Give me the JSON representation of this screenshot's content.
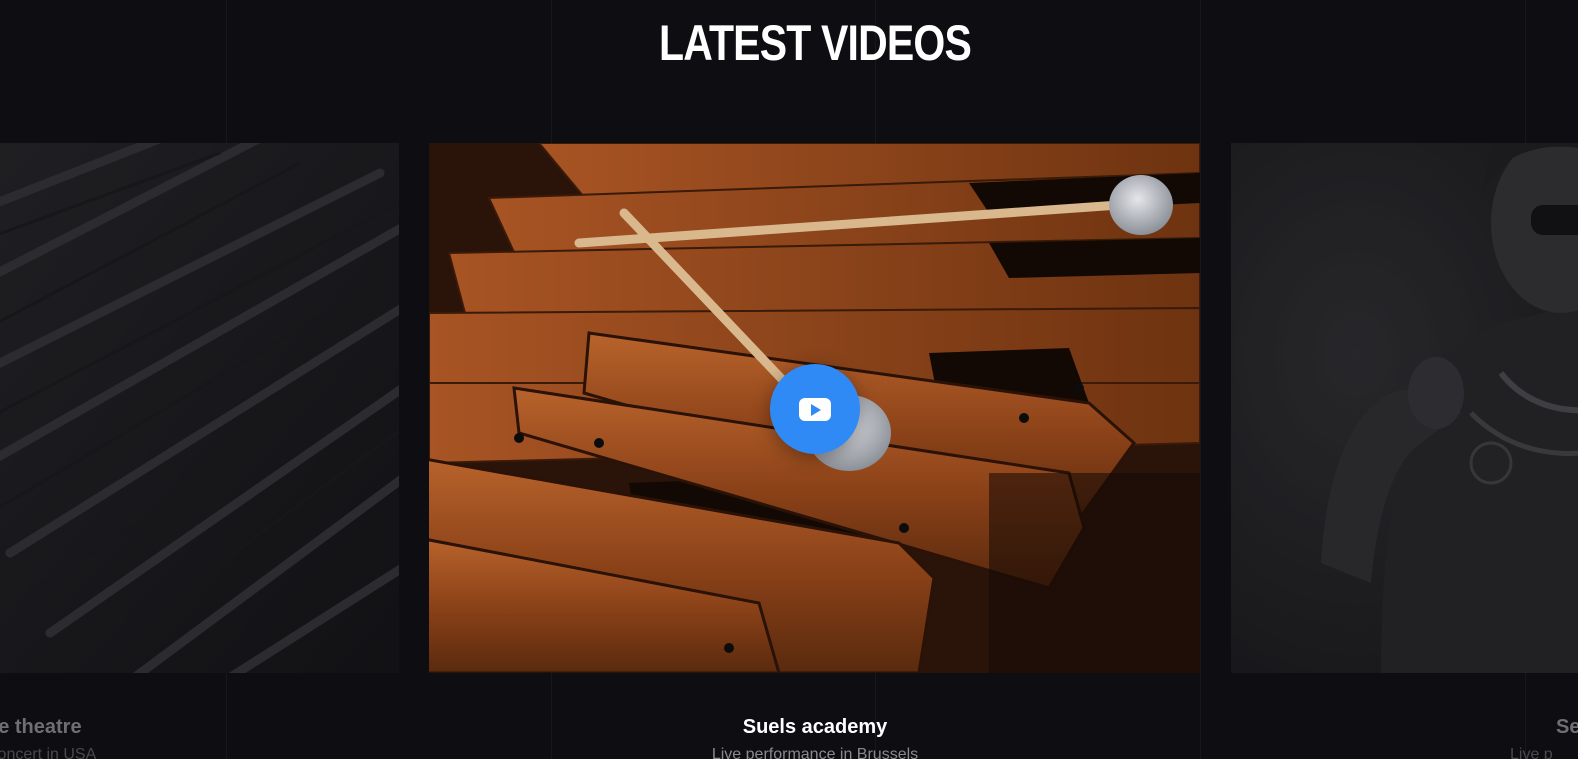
{
  "section": {
    "heading": "LATEST VIDEOS"
  },
  "videos": [
    {
      "title": "pe theatre",
      "subtitle": "Concert in USA"
    },
    {
      "title": "Suels academy",
      "subtitle": "Live performance in Brussels"
    },
    {
      "title": "Se",
      "subtitle": "Live p"
    }
  ],
  "icons": {
    "play": "youtube-play-icon"
  },
  "colors": {
    "background": "#0e0d12",
    "accent": "#2f8af5",
    "title": "#ffffff",
    "muted": "#6f6e74"
  }
}
